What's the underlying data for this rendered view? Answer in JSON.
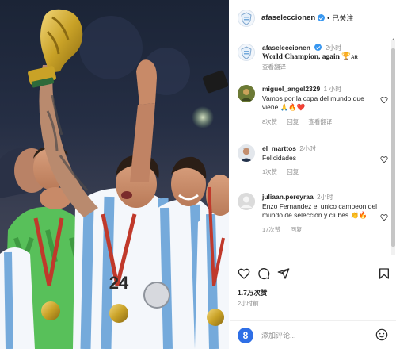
{
  "header": {
    "username": "afaseleccionen",
    "separator": "•",
    "follow_status": "已关注"
  },
  "caption": {
    "username": "afaseleccionen",
    "time": "2小时",
    "text": "World Champion, again",
    "trophy_emoji": "🏆",
    "flag_suffix": "AR",
    "translate": "查看翻译"
  },
  "comments": [
    {
      "username": "miguel_angel2329",
      "time": "1 小时",
      "text": "Vamos por la copa del mundo que viene 🙏🔥❤️.",
      "likes": "8次赞",
      "reply": "回复",
      "translate": "查看翻译"
    },
    {
      "username": "el_marttos",
      "time": "2小时",
      "text": "Felicidades",
      "likes": "1次赞",
      "reply": "回复"
    },
    {
      "username": "juliaan.pereyraa",
      "time": "2小时",
      "text": "Enzo Fernandez el unico campeon del mundo de seleccion y clubes 👏🔥",
      "likes": "17次赞",
      "reply": "回复"
    }
  ],
  "post": {
    "likes": "1.7万次赞",
    "time_ago": "2小时前"
  },
  "comment_bar": {
    "badge": "8",
    "placeholder": "添加评论..."
  },
  "colors": {
    "verified": "#3897f0",
    "argentina_sky": "#75aadb",
    "trophy_gold": "#c9a227"
  }
}
